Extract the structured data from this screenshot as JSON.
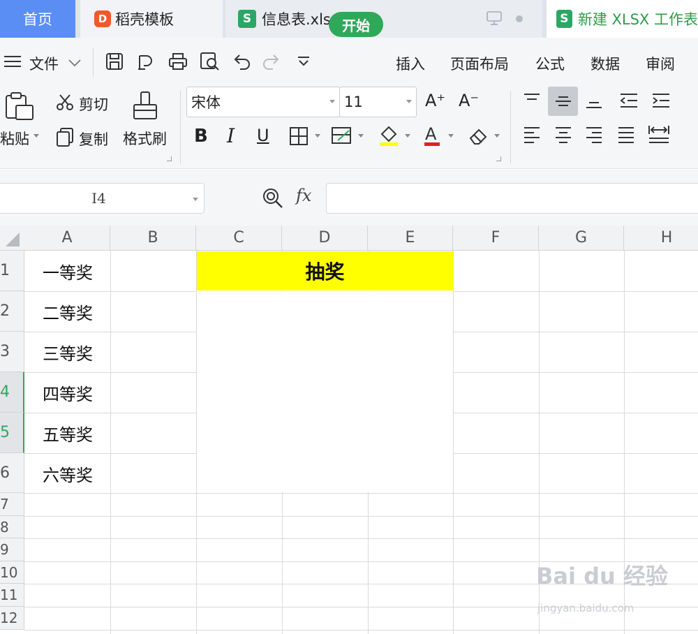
{
  "tabs": {
    "home": "首页",
    "template": "稻壳模板",
    "file1": "信息表.xlsx",
    "new_file": "新建 XLSX 工作表"
  },
  "menu": {
    "file": "文件",
    "items": [
      "开始",
      "插入",
      "页面布局",
      "公式",
      "数据",
      "审阅"
    ]
  },
  "ribbon": {
    "paste": "粘贴",
    "cut": "剪切",
    "copy": "复制",
    "format_painter": "格式刷",
    "font_name": "宋体",
    "font_size": "11",
    "increase_font": "A⁺",
    "decrease_font": "A⁻"
  },
  "formula_bar": {
    "cell_ref": "I4",
    "fx": "fx",
    "value": ""
  },
  "columns": [
    "A",
    "B",
    "C",
    "D",
    "E",
    "F",
    "G",
    "H"
  ],
  "rows": [
    "1",
    "2",
    "3",
    "4",
    "5",
    "6",
    "7",
    "8",
    "9",
    "10",
    "11",
    "12"
  ],
  "selected_rows": [
    "4",
    "5"
  ],
  "cells": {
    "A1": "一等奖",
    "A2": "二等奖",
    "A3": "三等奖",
    "A4": "四等奖",
    "A5": "五等奖",
    "A6": "六等奖",
    "C1": "抽奖"
  },
  "colors": {
    "accent_green": "#2fa85a",
    "home_tab_blue": "#5b8ef5",
    "title_fill": "#ffff00"
  },
  "watermark": {
    "main": "Bai du 经验",
    "sub": "jingyan.baidu.com"
  }
}
